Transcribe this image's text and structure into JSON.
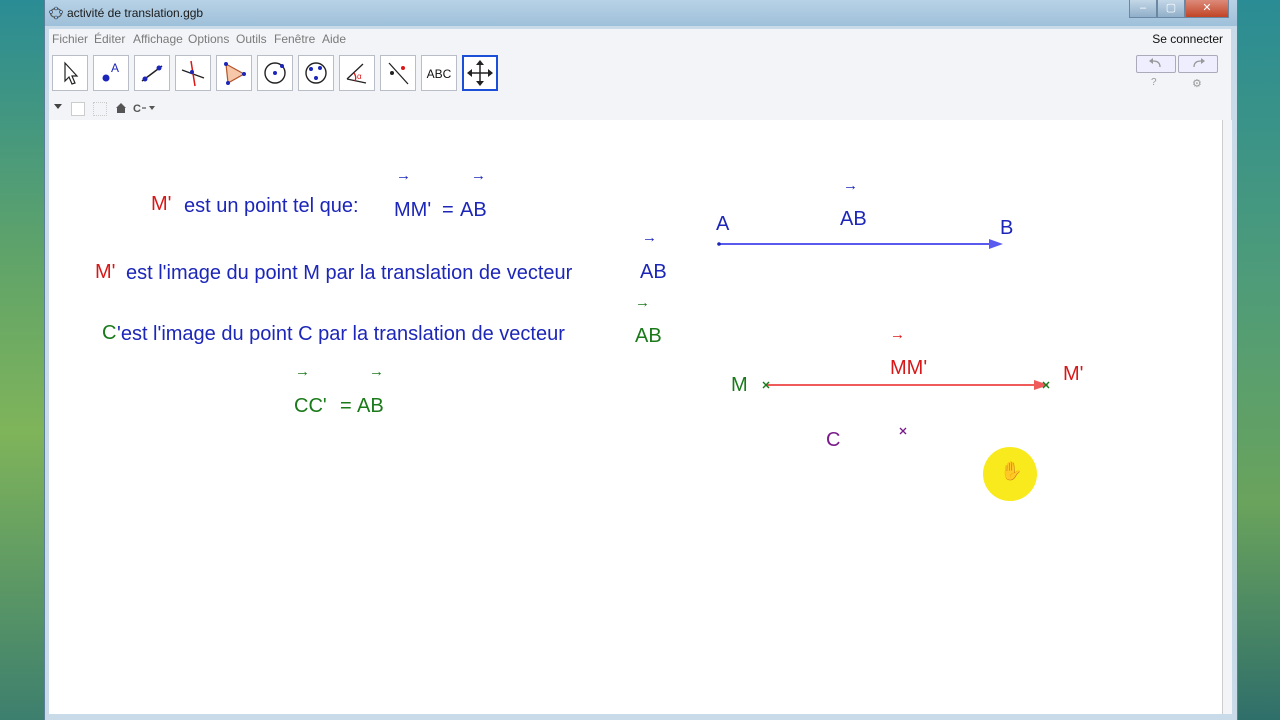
{
  "window": {
    "title": "activité de translation.ggb",
    "controls": [
      "–",
      "▢",
      "✕"
    ]
  },
  "menu": {
    "items": [
      "Fichier",
      "Éditer",
      "Affichage",
      "Options",
      "Outils",
      "Fenêtre",
      "Aide"
    ],
    "connect": "Se connecter"
  },
  "toolbar": {
    "tools": [
      "move-tool",
      "point-tool",
      "line-tool",
      "perpendicular-tool",
      "polygon-tool",
      "circle-tool",
      "circle-three-points-tool",
      "angle-tool",
      "reflect-tool",
      "text-tool",
      "move-graphics-tool"
    ],
    "text_tool_label": "ABC",
    "active_tool": "move-graphics-tool"
  },
  "canvas": {
    "line1": {
      "prime": "M'",
      "text": "est un point tel que:",
      "eq_left": "MM'",
      "eq_sign": "=",
      "eq_right": "AB"
    },
    "line2": {
      "prime": "M'",
      "text": "est l'image du point M par la translation de vecteur",
      "vec": "AB"
    },
    "line3": {
      "prime": "C",
      "text": "'est l'image du point C par la translation de vecteur",
      "vec": "AB"
    },
    "line4": {
      "left": "CC'",
      "sign": "=",
      "right": "AB"
    },
    "vector_ab": {
      "start": "A",
      "end": "B",
      "label": "AB"
    },
    "vector_mm": {
      "start": "M",
      "end": "M'",
      "label": "MM'"
    },
    "point_c": {
      "label": "C"
    },
    "arrow_glyph": "→"
  },
  "colors": {
    "red": "#d81818",
    "blue": "#1c26b8",
    "green": "#1a7a1a",
    "purple": "#7a1a8a"
  }
}
